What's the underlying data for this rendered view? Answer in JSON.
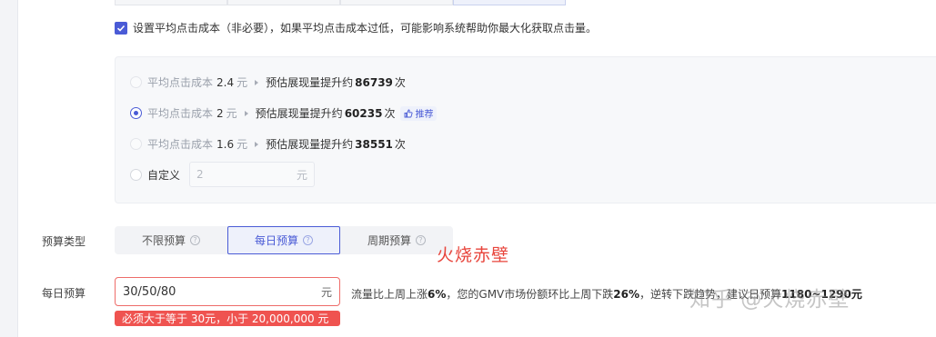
{
  "cpc_setting": {
    "checkbox_label": "设置平均点击成本（非必要），如果平均点击成本过低，可能影响系统帮助你最大化获取点击量。",
    "checked": true
  },
  "cpc_options": [
    {
      "label": "平均点击成本",
      "value": "2.4",
      "unit": "元",
      "est_text": "预估展现量提升约",
      "est_value": "86739",
      "est_unit": "次",
      "selected": false,
      "recommended": false
    },
    {
      "label": "平均点击成本",
      "value": "2",
      "unit": "元",
      "est_text": "预估展现量提升约",
      "est_value": "60235",
      "est_unit": "次",
      "selected": true,
      "recommended": true,
      "badge": "推荐"
    },
    {
      "label": "平均点击成本",
      "value": "1.6",
      "unit": "元",
      "est_text": "预估展现量提升约",
      "est_value": "38551",
      "est_unit": "次",
      "selected": false,
      "recommended": false
    }
  ],
  "custom_option": {
    "label": "自定义",
    "input_value": "2",
    "unit": "元"
  },
  "budget_type": {
    "label": "预算类型",
    "options": [
      "不限预算",
      "每日预算",
      "周期预算"
    ],
    "selected": "每日预算"
  },
  "daily_budget": {
    "label": "每日预算",
    "value": "30/50/80",
    "unit": "元",
    "error": "必须大于等于 30元，小于 20,000,000 元",
    "hint": {
      "p1": "流量比上周上涨",
      "v1": "6%",
      "p2": "，您的GMV市场份额环比上周下跌",
      "v2": "26%",
      "p3": "，逆转下跌趋势，建议日预算",
      "v3": "1180~1290元"
    }
  },
  "watermarks": {
    "red_text": "火烧赤壁",
    "zhihu_text": "知乎 @火烧赤壁"
  },
  "colors": {
    "accent": "#4a5bd6",
    "error": "#ef5350",
    "panel_bg": "#f7f8fa"
  }
}
